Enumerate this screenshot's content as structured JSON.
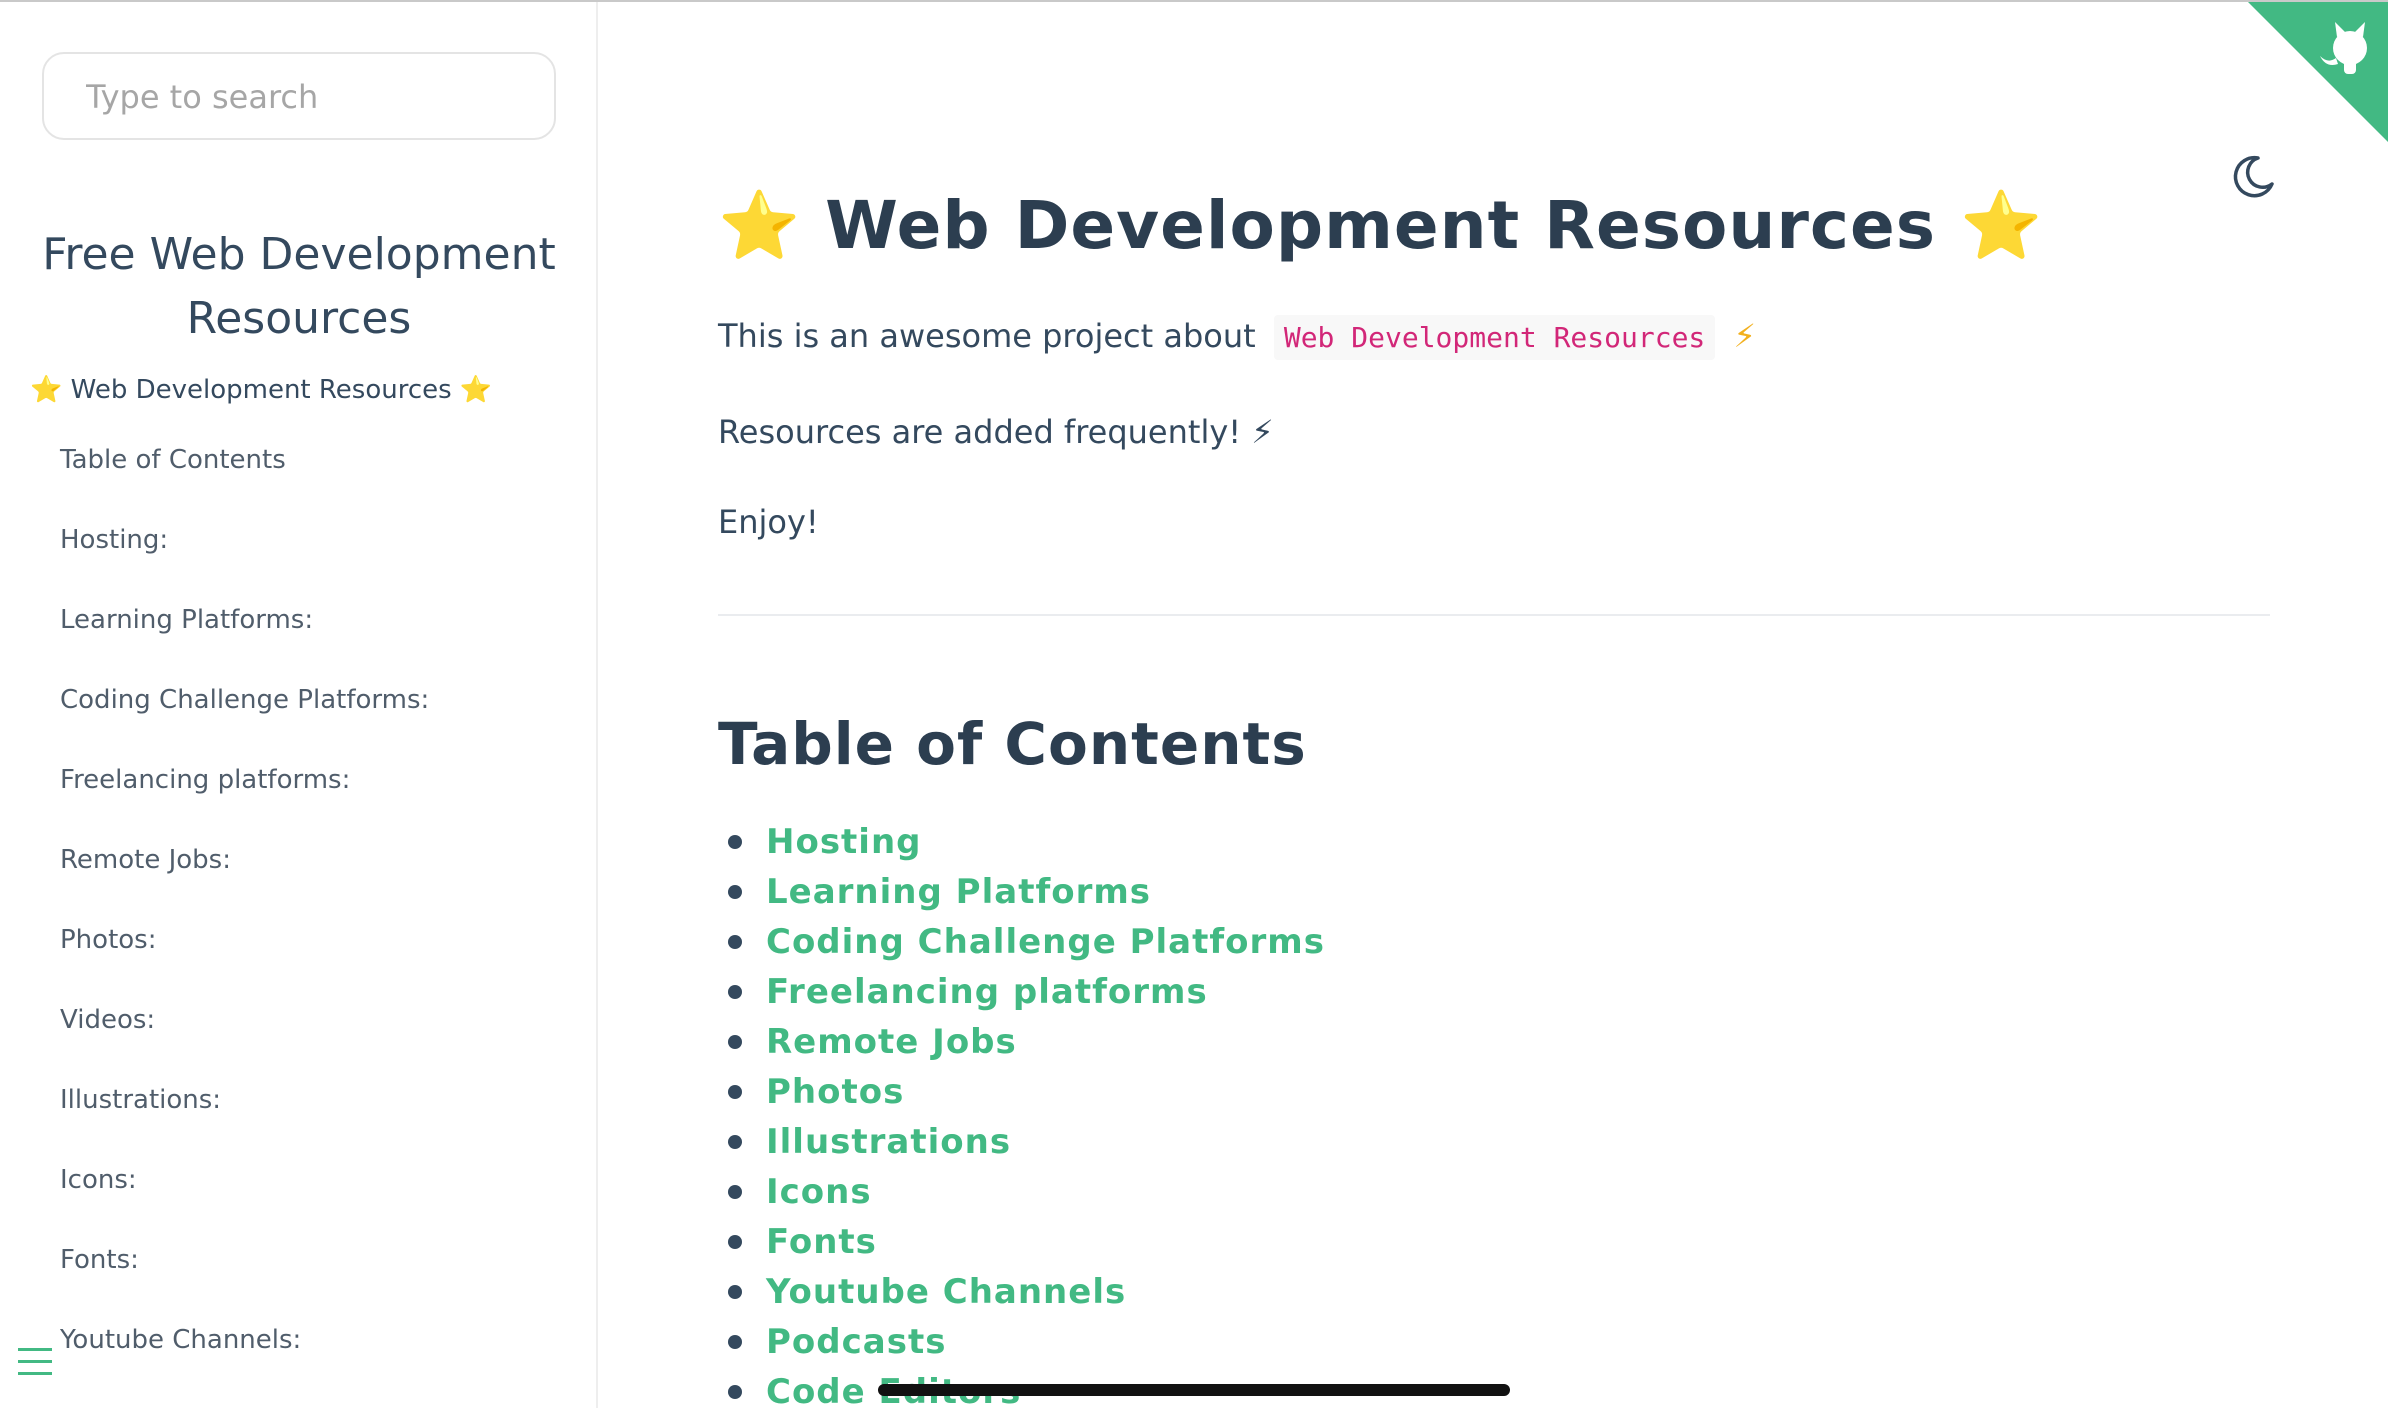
{
  "sidebar": {
    "search_placeholder": "Type to search",
    "app_name": "Free Web Development Resources",
    "top_item": "⭐ Web Development Resources ⭐",
    "items": [
      "Table of Contents",
      "Hosting:",
      "Learning Platforms:",
      "Coding Challenge Platforms:",
      "Freelancing platforms:",
      "Remote Jobs:",
      "Photos:",
      "Videos:",
      "Illustrations:",
      "Icons:",
      "Fonts:",
      "Youtube Channels:"
    ],
    "menu_icon": "hamburger-menu-icon"
  },
  "header": {
    "theme_icon": "moon-icon",
    "corner_icon": "github-octocat-icon",
    "accent_color": "#42b983"
  },
  "main": {
    "title": "⭐ Web Development Resources ⭐",
    "intro_text": "This is an awesome project about",
    "intro_code": "Web Development Resources",
    "intro_suffix": "⚡",
    "frequency_text": "Resources are added frequently! ⚡",
    "enjoy_text": "Enjoy!",
    "toc_heading": "Table of Contents",
    "toc": [
      "Hosting",
      "Learning Platforms",
      "Coding Challenge Platforms",
      "Freelancing platforms",
      "Remote Jobs",
      "Photos",
      "Illustrations",
      "Icons",
      "Fonts",
      "Youtube Channels",
      "Podcasts",
      "Code Editors"
    ]
  }
}
